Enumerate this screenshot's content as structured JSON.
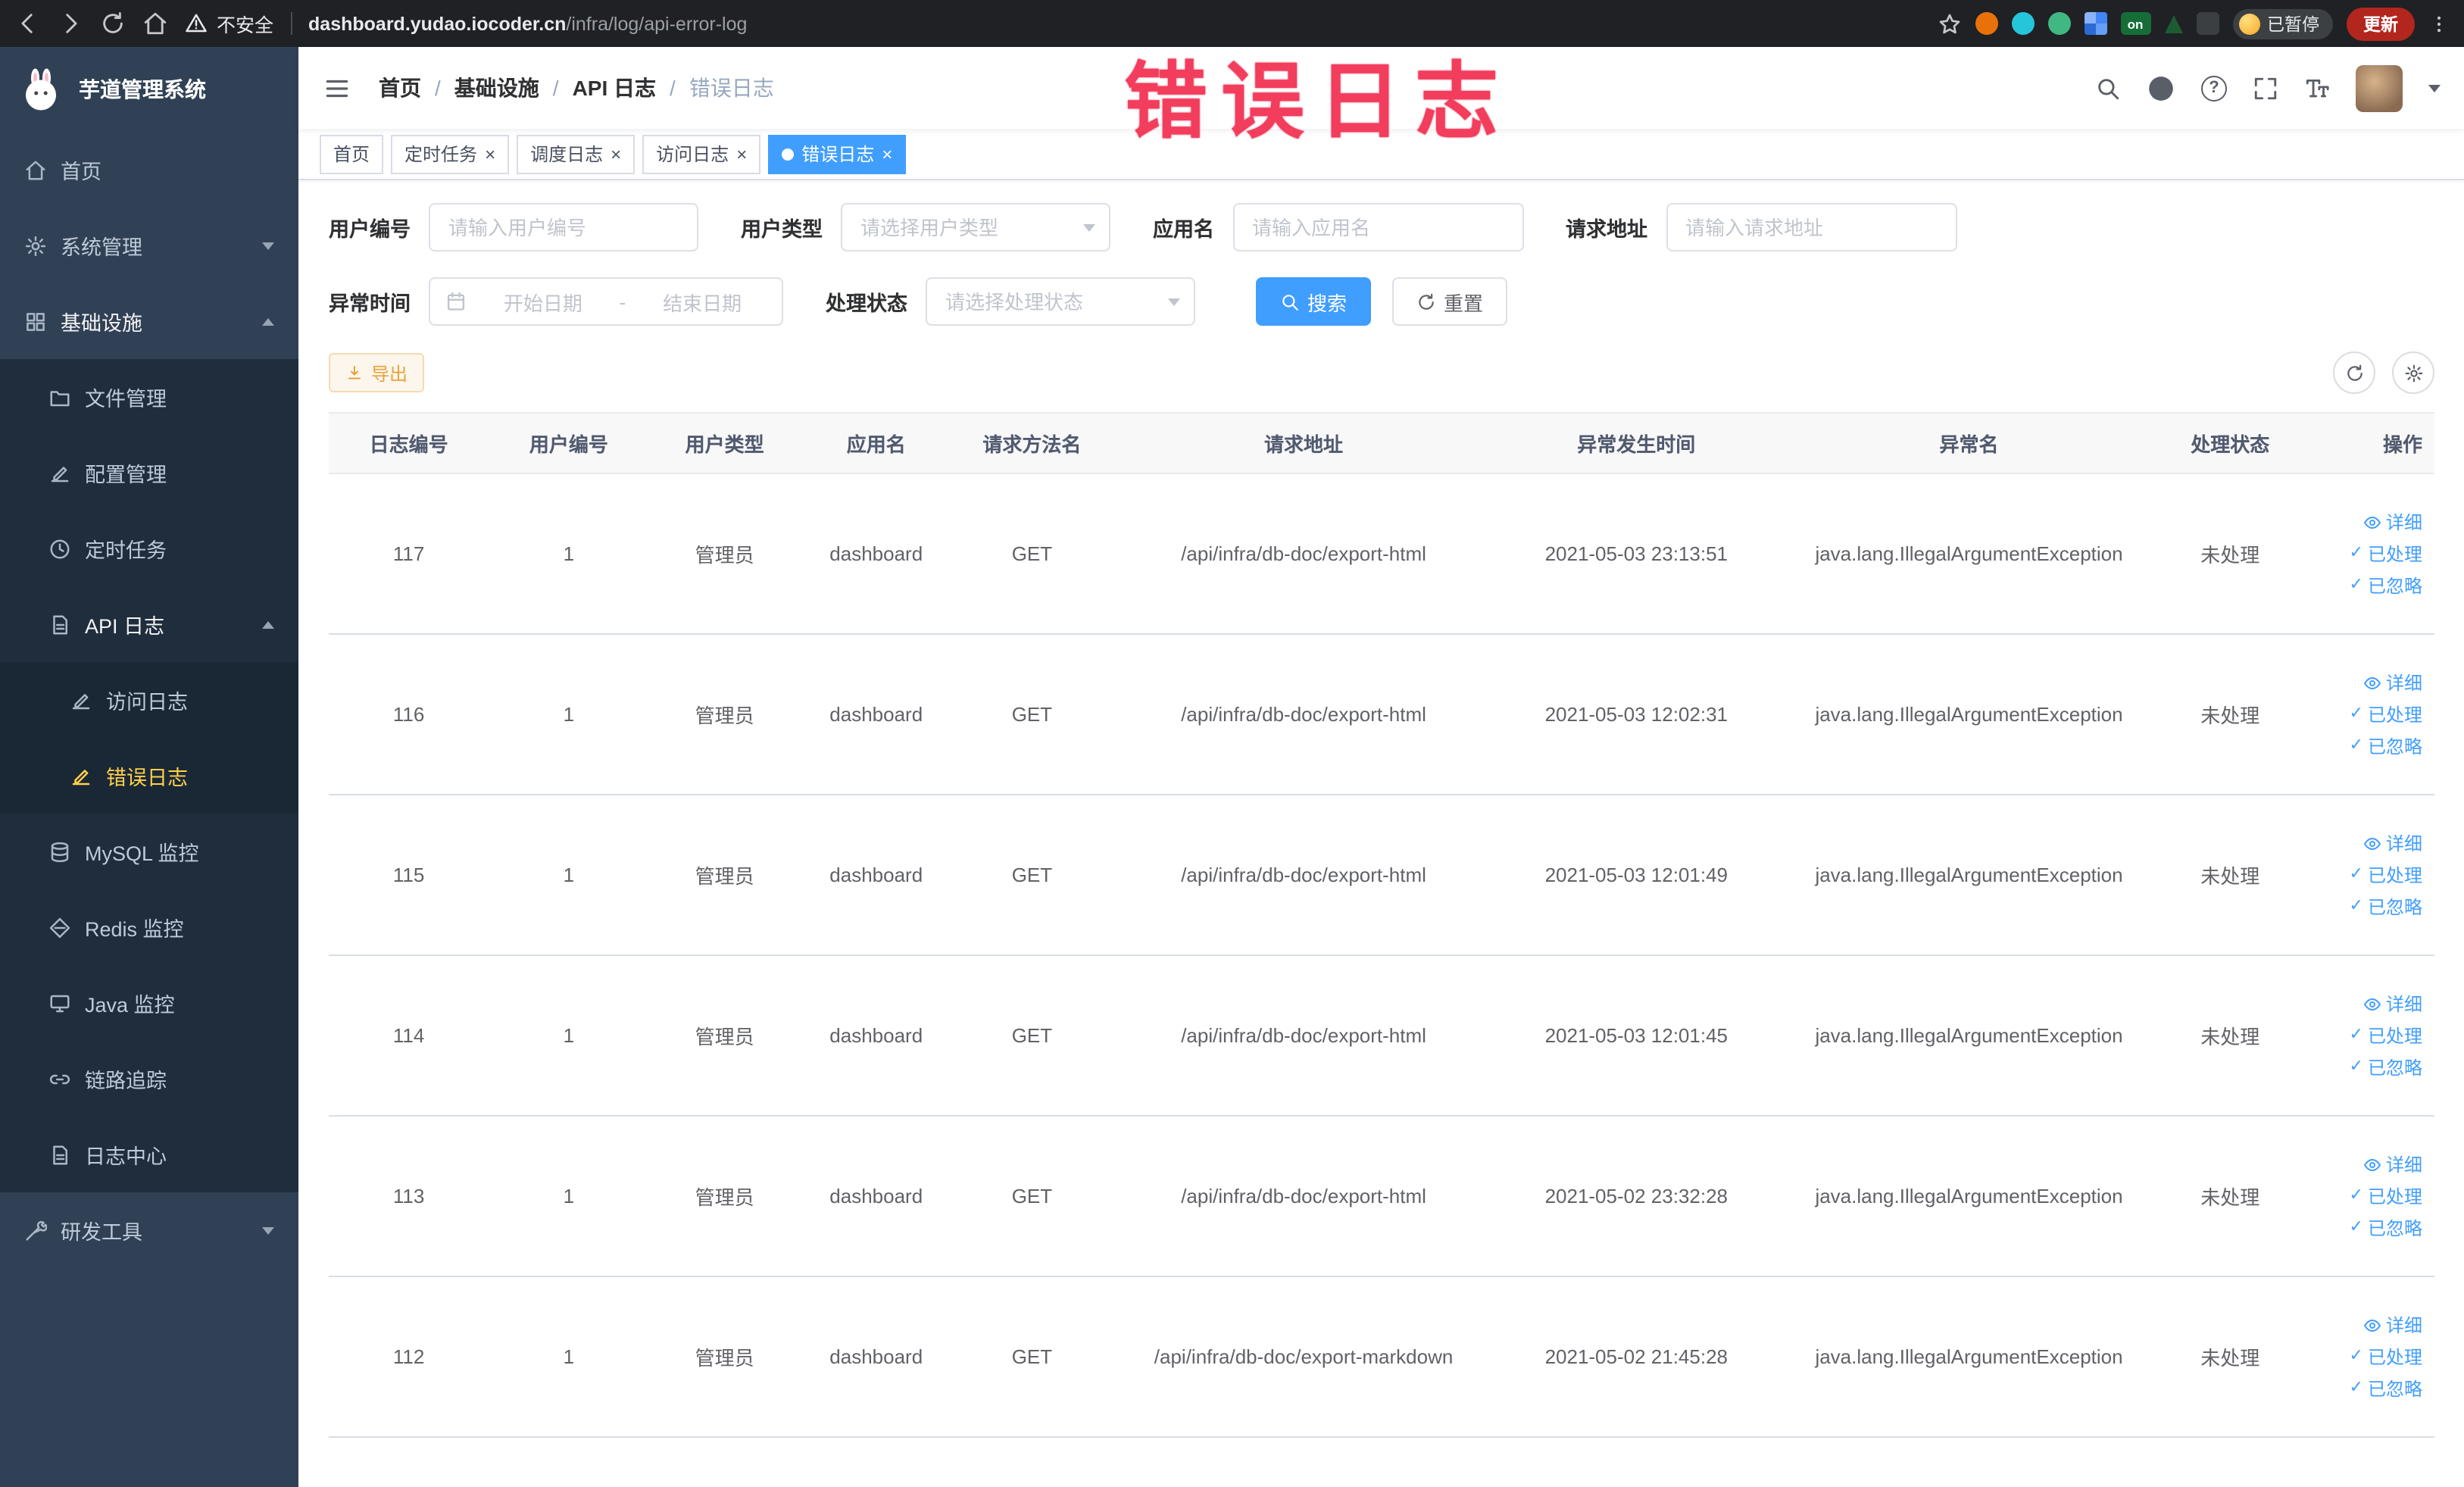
{
  "browser": {
    "security_label": "不安全",
    "url_host": "dashboard.yudao.iocoder.cn",
    "url_path": "/infra/log/api-error-log",
    "on_badge": "on",
    "paused_label": "已暂停",
    "update_label": "更新"
  },
  "sidebar": {
    "app_title": "芋道管理系统",
    "items": [
      {
        "label": "首页"
      },
      {
        "label": "系统管理"
      },
      {
        "label": "基础设施"
      },
      {
        "label": "文件管理"
      },
      {
        "label": "配置管理"
      },
      {
        "label": "定时任务"
      },
      {
        "label": "API 日志"
      },
      {
        "label": "访问日志"
      },
      {
        "label": "错误日志"
      },
      {
        "label": "MySQL 监控"
      },
      {
        "label": "Redis 监控"
      },
      {
        "label": "Java 监控"
      },
      {
        "label": "链路追踪"
      },
      {
        "label": "日志中心"
      },
      {
        "label": "研发工具"
      }
    ]
  },
  "header": {
    "breadcrumb": [
      "首页",
      "基础设施",
      "API 日志",
      "错误日志"
    ],
    "watermark": "错误日志"
  },
  "tabs": {
    "items": [
      {
        "label": "首页"
      },
      {
        "label": "定时任务"
      },
      {
        "label": "调度日志"
      },
      {
        "label": "访问日志"
      },
      {
        "label": "错误日志"
      }
    ]
  },
  "filters": {
    "user_id": {
      "label": "用户编号",
      "placeholder": "请输入用户编号"
    },
    "user_type": {
      "label": "用户类型",
      "placeholder": "请选择用户类型"
    },
    "app_name": {
      "label": "应用名",
      "placeholder": "请输入应用名"
    },
    "request_url": {
      "label": "请求地址",
      "placeholder": "请输入请求地址"
    },
    "exception_time": {
      "label": "异常时间",
      "start_placeholder": "开始日期",
      "end_placeholder": "结束日期"
    },
    "process_status": {
      "label": "处理状态",
      "placeholder": "请选择处理状态"
    },
    "search_button": "搜索",
    "reset_button": "重置"
  },
  "toolbar": {
    "export_button": "导出"
  },
  "table": {
    "columns": [
      "日志编号",
      "用户编号",
      "用户类型",
      "应用名",
      "请求方法名",
      "请求地址",
      "异常发生时间",
      "异常名",
      "处理状态",
      "操作"
    ],
    "actions": [
      "详细",
      "已处理",
      "已忽略"
    ],
    "rows": [
      {
        "id": "117",
        "user_id": "1",
        "user_type": "管理员",
        "app": "dashboard",
        "method": "GET",
        "url": "/api/infra/db-doc/export-html",
        "time": "2021-05-03 23:13:51",
        "exception": "java.lang.IllegalArgumentException",
        "status": "未处理"
      },
      {
        "id": "116",
        "user_id": "1",
        "user_type": "管理员",
        "app": "dashboard",
        "method": "GET",
        "url": "/api/infra/db-doc/export-html",
        "time": "2021-05-03 12:02:31",
        "exception": "java.lang.IllegalArgumentException",
        "status": "未处理"
      },
      {
        "id": "115",
        "user_id": "1",
        "user_type": "管理员",
        "app": "dashboard",
        "method": "GET",
        "url": "/api/infra/db-doc/export-html",
        "time": "2021-05-03 12:01:49",
        "exception": "java.lang.IllegalArgumentException",
        "status": "未处理"
      },
      {
        "id": "114",
        "user_id": "1",
        "user_type": "管理员",
        "app": "dashboard",
        "method": "GET",
        "url": "/api/infra/db-doc/export-html",
        "time": "2021-05-03 12:01:45",
        "exception": "java.lang.IllegalArgumentException",
        "status": "未处理"
      },
      {
        "id": "113",
        "user_id": "1",
        "user_type": "管理员",
        "app": "dashboard",
        "method": "GET",
        "url": "/api/infra/db-doc/export-html",
        "time": "2021-05-02 23:32:28",
        "exception": "java.lang.IllegalArgumentException",
        "status": "未处理"
      },
      {
        "id": "112",
        "user_id": "1",
        "user_type": "管理员",
        "app": "dashboard",
        "method": "GET",
        "url": "/api/infra/db-doc/export-markdown",
        "time": "2021-05-02 21:45:28",
        "exception": "java.lang.IllegalArgumentException",
        "status": "未处理"
      }
    ]
  },
  "glyphs": {
    "close": "×",
    "check": "✓",
    "sep": "/",
    "date_sep": "-",
    "question": "?"
  }
}
